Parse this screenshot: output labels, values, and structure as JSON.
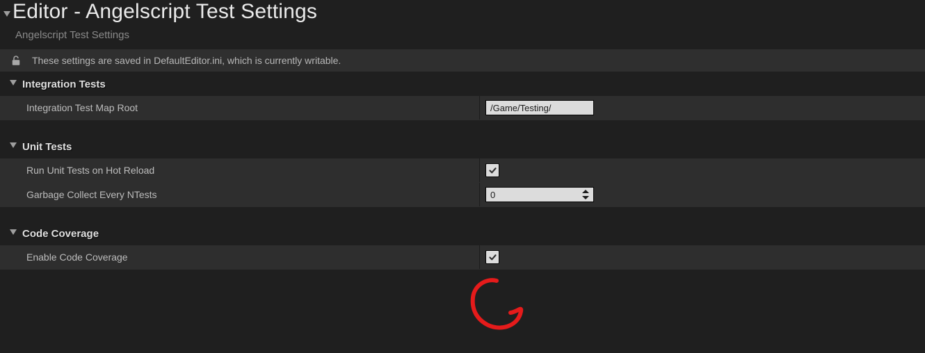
{
  "header": {
    "title": "Editor - Angelscript Test Settings",
    "subtitle": "Angelscript Test Settings"
  },
  "save_info": {
    "text": "These settings are saved in DefaultEditor.ini, which is currently writable."
  },
  "sections": {
    "integration": {
      "title": "Integration Tests",
      "map_root_label": "Integration Test Map Root",
      "map_root_value": "/Game/Testing/"
    },
    "unit": {
      "title": "Unit Tests",
      "hot_reload_label": "Run Unit Tests on Hot Reload",
      "hot_reload_checked": true,
      "gc_label": "Garbage Collect Every NTests",
      "gc_value": "0"
    },
    "coverage": {
      "title": "Code Coverage",
      "enable_label": "Enable Code Coverage",
      "enable_checked": true
    }
  }
}
